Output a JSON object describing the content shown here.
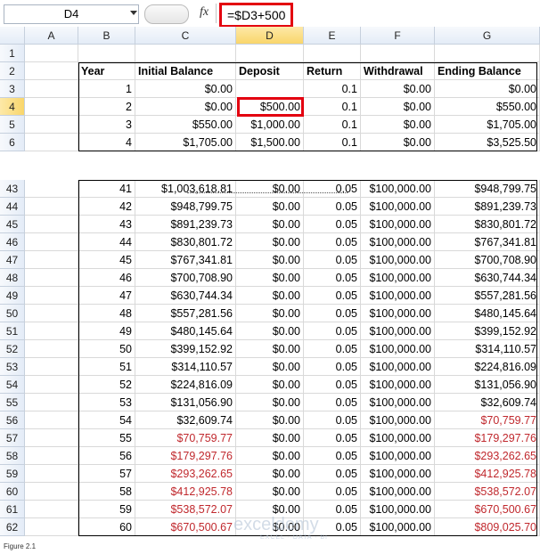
{
  "name_box": "D4",
  "formula": "=$D3+500",
  "fx_label": "fx",
  "columns": [
    "A",
    "B",
    "C",
    "D",
    "E",
    "F",
    "G"
  ],
  "headers": {
    "year": "Year",
    "initial": "Initial Balance",
    "deposit": "Deposit",
    "return": "Return",
    "withdrawal": "Withdrawal",
    "ending": "Ending Balance"
  },
  "top_rows": [
    {
      "row": "1",
      "year": "",
      "initial": "",
      "deposit": "",
      "ret": "",
      "withdrawal": "",
      "ending": ""
    },
    {
      "row": "2",
      "header": true
    },
    {
      "row": "3",
      "year": "1",
      "initial": "$0.00",
      "deposit": "",
      "ret": "0.1",
      "withdrawal": "$0.00",
      "ending": "$0.00"
    },
    {
      "row": "4",
      "year": "2",
      "initial": "$0.00",
      "deposit": "$500.00",
      "ret": "0.1",
      "withdrawal": "$0.00",
      "ending": "$550.00"
    },
    {
      "row": "5",
      "year": "3",
      "initial": "$550.00",
      "deposit": "$1,000.00",
      "ret": "0.1",
      "withdrawal": "$0.00",
      "ending": "$1,705.00"
    },
    {
      "row": "6",
      "year": "4",
      "initial": "$1,705.00",
      "deposit": "$1,500.00",
      "ret": "0.1",
      "withdrawal": "$0.00",
      "ending": "$3,525.50"
    }
  ],
  "bottom_rows": [
    {
      "row": "43",
      "year": "41",
      "initial": "$1,003,618.81",
      "deposit": "$0.00",
      "ret": "0.05",
      "withdrawal": "$100,000.00",
      "ending": "$948,799.75",
      "red_i": false,
      "red_e": false
    },
    {
      "row": "44",
      "year": "42",
      "initial": "$948,799.75",
      "deposit": "$0.00",
      "ret": "0.05",
      "withdrawal": "$100,000.00",
      "ending": "$891,239.73",
      "red_i": false,
      "red_e": false
    },
    {
      "row": "45",
      "year": "43",
      "initial": "$891,239.73",
      "deposit": "$0.00",
      "ret": "0.05",
      "withdrawal": "$100,000.00",
      "ending": "$830,801.72",
      "red_i": false,
      "red_e": false
    },
    {
      "row": "46",
      "year": "44",
      "initial": "$830,801.72",
      "deposit": "$0.00",
      "ret": "0.05",
      "withdrawal": "$100,000.00",
      "ending": "$767,341.81",
      "red_i": false,
      "red_e": false
    },
    {
      "row": "47",
      "year": "45",
      "initial": "$767,341.81",
      "deposit": "$0.00",
      "ret": "0.05",
      "withdrawal": "$100,000.00",
      "ending": "$700,708.90",
      "red_i": false,
      "red_e": false
    },
    {
      "row": "48",
      "year": "46",
      "initial": "$700,708.90",
      "deposit": "$0.00",
      "ret": "0.05",
      "withdrawal": "$100,000.00",
      "ending": "$630,744.34",
      "red_i": false,
      "red_e": false
    },
    {
      "row": "49",
      "year": "47",
      "initial": "$630,744.34",
      "deposit": "$0.00",
      "ret": "0.05",
      "withdrawal": "$100,000.00",
      "ending": "$557,281.56",
      "red_i": false,
      "red_e": false
    },
    {
      "row": "50",
      "year": "48",
      "initial": "$557,281.56",
      "deposit": "$0.00",
      "ret": "0.05",
      "withdrawal": "$100,000.00",
      "ending": "$480,145.64",
      "red_i": false,
      "red_e": false
    },
    {
      "row": "51",
      "year": "49",
      "initial": "$480,145.64",
      "deposit": "$0.00",
      "ret": "0.05",
      "withdrawal": "$100,000.00",
      "ending": "$399,152.92",
      "red_i": false,
      "red_e": false
    },
    {
      "row": "52",
      "year": "50",
      "initial": "$399,152.92",
      "deposit": "$0.00",
      "ret": "0.05",
      "withdrawal": "$100,000.00",
      "ending": "$314,110.57",
      "red_i": false,
      "red_e": false
    },
    {
      "row": "53",
      "year": "51",
      "initial": "$314,110.57",
      "deposit": "$0.00",
      "ret": "0.05",
      "withdrawal": "$100,000.00",
      "ending": "$224,816.09",
      "red_i": false,
      "red_e": false
    },
    {
      "row": "54",
      "year": "52",
      "initial": "$224,816.09",
      "deposit": "$0.00",
      "ret": "0.05",
      "withdrawal": "$100,000.00",
      "ending": "$131,056.90",
      "red_i": false,
      "red_e": false
    },
    {
      "row": "55",
      "year": "53",
      "initial": "$131,056.90",
      "deposit": "$0.00",
      "ret": "0.05",
      "withdrawal": "$100,000.00",
      "ending": "$32,609.74",
      "red_i": false,
      "red_e": false
    },
    {
      "row": "56",
      "year": "54",
      "initial": "$32,609.74",
      "deposit": "$0.00",
      "ret": "0.05",
      "withdrawal": "$100,000.00",
      "ending": "$70,759.77",
      "red_i": false,
      "red_e": true
    },
    {
      "row": "57",
      "year": "55",
      "initial": "$70,759.77",
      "deposit": "$0.00",
      "ret": "0.05",
      "withdrawal": "$100,000.00",
      "ending": "$179,297.76",
      "red_i": true,
      "red_e": true
    },
    {
      "row": "58",
      "year": "56",
      "initial": "$179,297.76",
      "deposit": "$0.00",
      "ret": "0.05",
      "withdrawal": "$100,000.00",
      "ending": "$293,262.65",
      "red_i": true,
      "red_e": true
    },
    {
      "row": "59",
      "year": "57",
      "initial": "$293,262.65",
      "deposit": "$0.00",
      "ret": "0.05",
      "withdrawal": "$100,000.00",
      "ending": "$412,925.78",
      "red_i": true,
      "red_e": true
    },
    {
      "row": "60",
      "year": "58",
      "initial": "$412,925.78",
      "deposit": "$0.00",
      "ret": "0.05",
      "withdrawal": "$100,000.00",
      "ending": "$538,572.07",
      "red_i": true,
      "red_e": true
    },
    {
      "row": "61",
      "year": "59",
      "initial": "$538,572.07",
      "deposit": "$0.00",
      "ret": "0.05",
      "withdrawal": "$100,000.00",
      "ending": "$670,500.67",
      "red_i": true,
      "red_e": true
    },
    {
      "row": "62",
      "year": "60",
      "initial": "$670,500.67",
      "deposit": "$0.00",
      "ret": "0.05",
      "withdrawal": "$100,000.00",
      "ending": "$809,025.70",
      "red_i": true,
      "red_e": true
    }
  ],
  "colors": {
    "negative": "#c0282d",
    "highlight": "#e3000f",
    "selected_header": "#f9d66b"
  },
  "selected_cell": "D4",
  "caption": "Figure 2.1",
  "watermark": "exceldemy",
  "watermark_sub": "EXCEL · DATA · BI"
}
